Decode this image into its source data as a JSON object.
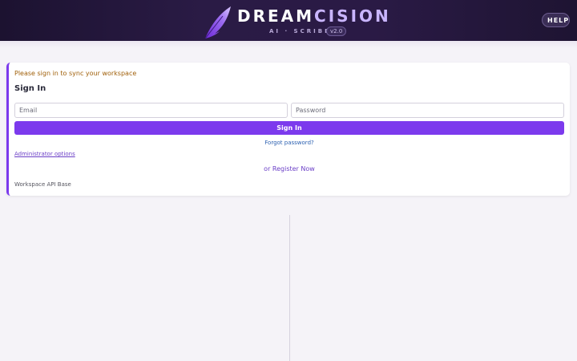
{
  "header": {
    "brand_part1": "DREAM",
    "brand_part2": "CISION",
    "tagline": "AI · SCRIBE",
    "version": "v2.0",
    "help_label": "HELP"
  },
  "signin": {
    "notice": "Please sign in to sync your workspace",
    "title": "Sign In",
    "email_placeholder": "Email",
    "password_placeholder": "Password",
    "email_value": "",
    "password_value": "",
    "submit_label": "Sign In",
    "forgot_label": "Forgot password?",
    "admin_label": "Administrator options",
    "register_label": "or Register Now",
    "api_base_label": "Workspace API Base"
  },
  "colors": {
    "accent": "#7c3aed",
    "header_bg": "#2a1b45",
    "notice": "#a0600a"
  },
  "icons": {
    "logo": "feather-quill-icon"
  }
}
